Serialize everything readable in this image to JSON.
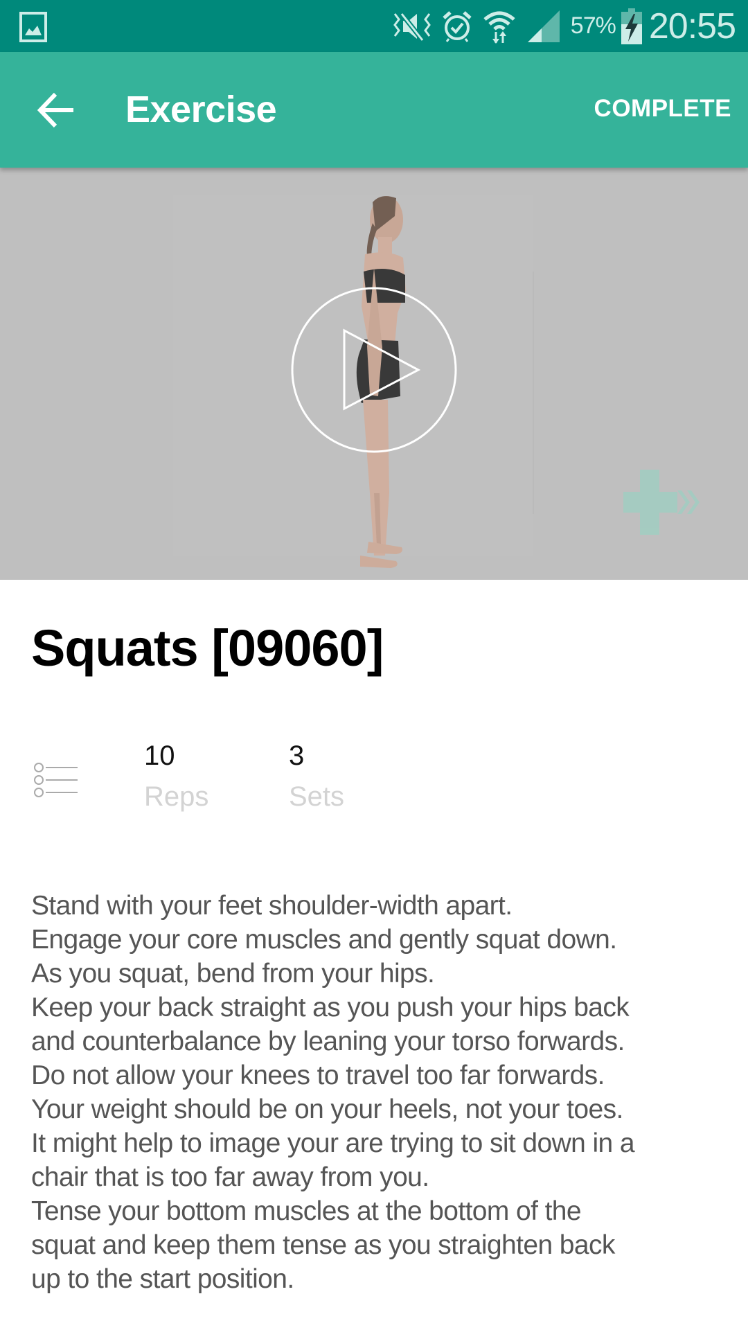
{
  "status_bar": {
    "battery_percent": "57%",
    "time": "20:55",
    "icons": [
      "gallery-notification-icon",
      "vibrate-mute-icon",
      "alarm-icon",
      "wifi-icon",
      "cell-signal-icon",
      "battery-charging-icon"
    ]
  },
  "app_bar": {
    "title": "Exercise",
    "back_icon": "arrow-left-icon",
    "action_label": "COMPLETE"
  },
  "video": {
    "play_icon": "play-circle-icon",
    "watermark_icon": "medical-cross-logo-icon"
  },
  "exercise": {
    "title": "Squats [09060]",
    "stats_icon": "list-icon",
    "reps": {
      "value": "10",
      "label": "Reps"
    },
    "sets": {
      "value": "3",
      "label": "Sets"
    },
    "description_lines": [
      "Stand with your feet shoulder-width apart.",
      "Engage your core muscles and gently squat down.",
      "As you squat, bend from your hips.",
      "Keep your back straight as you push your hips back",
      "and counterbalance by leaning your torso forwards.",
      "Do not allow your knees to travel too far forwards.",
      "Your weight should be on your heels, not your toes.",
      "It might help to image your are trying to sit down in a",
      "chair that is too far away from you.",
      "Tense your bottom muscles at the bottom of the",
      "squat and keep them tense as you straighten back",
      "up to the start position."
    ]
  },
  "colors": {
    "status_bar": "#00897B",
    "app_bar": "#35B39A",
    "video_bg": "#BFBFBF",
    "label_gray": "#D3D3D3",
    "body_text": "#555555"
  }
}
